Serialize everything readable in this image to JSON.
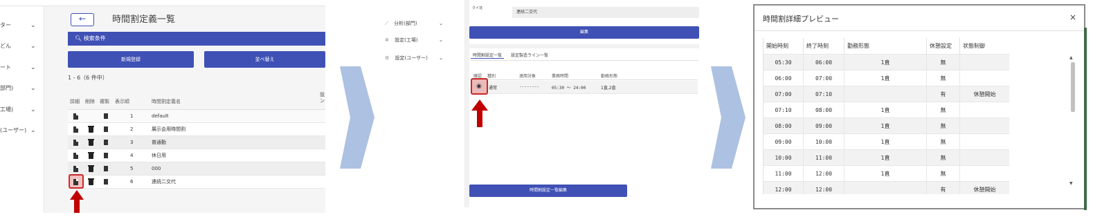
{
  "panel1": {
    "sidebar_items": [
      {
        "label": "ター"
      },
      {
        "label": "どん"
      },
      {
        "label": "ート"
      },
      {
        "label": "部門)"
      },
      {
        "label": "工場)"
      },
      {
        "label": "(ユーザー)"
      }
    ],
    "back_arrow": "←",
    "title": "時間割定義一覧",
    "search_label": "検索条件",
    "new_button": "新規登録",
    "sort_button": "並べ替え",
    "count_text": "1 - 6（6 件中）",
    "columns": {
      "detail": "詳細",
      "delete": "削除",
      "copy": "複製",
      "order": "表示順",
      "name": "時間割定義名",
      "extra": "設\nン"
    },
    "rows": [
      {
        "order": "1",
        "name": "default",
        "deletable": false
      },
      {
        "order": "2",
        "name": "展示会用時間割",
        "deletable": true
      },
      {
        "order": "3",
        "name": "普通勤",
        "deletable": true
      },
      {
        "order": "4",
        "name": "休日用",
        "deletable": true
      },
      {
        "order": "5",
        "name": "000",
        "deletable": true
      },
      {
        "order": "6",
        "name": "連続二交代",
        "deletable": true
      }
    ]
  },
  "panel2": {
    "sidebar_items": [
      {
        "label": "分析(部門)"
      },
      {
        "label": "設定(工場)"
      },
      {
        "label": "設定(ユーザー)"
      }
    ],
    "field_label": "タイ達",
    "field_value": "連続二交代",
    "edit_button": "編集",
    "tabs": [
      "時間割設定一覧",
      "設定製造ライン一覧"
    ],
    "columns": [
      "確認",
      "種別",
      "適用対象",
      "業務時間",
      "勤務形態"
    ],
    "row": {
      "type": "通常",
      "target": "--------",
      "time": "05:30 〜 24:00",
      "pattern": "1直,2直"
    },
    "bottom_button": "時間割設定一覧編集"
  },
  "modal": {
    "title": "時間割詳細プレビュー",
    "close": "×",
    "columns": [
      "開始時刻",
      "終了時刻",
      "勤務形態",
      "休憩設定",
      "状態制御"
    ],
    "rows": [
      {
        "start": "05:30",
        "end": "06:00",
        "pattern": "1直",
        "break": "無",
        "state": ""
      },
      {
        "start": "06:00",
        "end": "07:00",
        "pattern": "1直",
        "break": "無",
        "state": ""
      },
      {
        "start": "07:00",
        "end": "07:10",
        "pattern": "",
        "break": "有",
        "state": "休憩開始"
      },
      {
        "start": "07:10",
        "end": "08:00",
        "pattern": "1直",
        "break": "無",
        "state": ""
      },
      {
        "start": "08:00",
        "end": "09:00",
        "pattern": "1直",
        "break": "無",
        "state": ""
      },
      {
        "start": "09:00",
        "end": "10:00",
        "pattern": "1直",
        "break": "無",
        "state": ""
      },
      {
        "start": "10:00",
        "end": "11:00",
        "pattern": "1直",
        "break": "無",
        "state": ""
      },
      {
        "start": "11:00",
        "end": "12:00",
        "pattern": "1直",
        "break": "無",
        "state": ""
      },
      {
        "start": "12:00",
        "end": "12:00",
        "pattern": "",
        "break": "有",
        "state": "休憩開始"
      }
    ]
  },
  "colors": {
    "primary": "#3f51b5",
    "highlight": "#c62828",
    "chevron": "#adc1e2"
  }
}
